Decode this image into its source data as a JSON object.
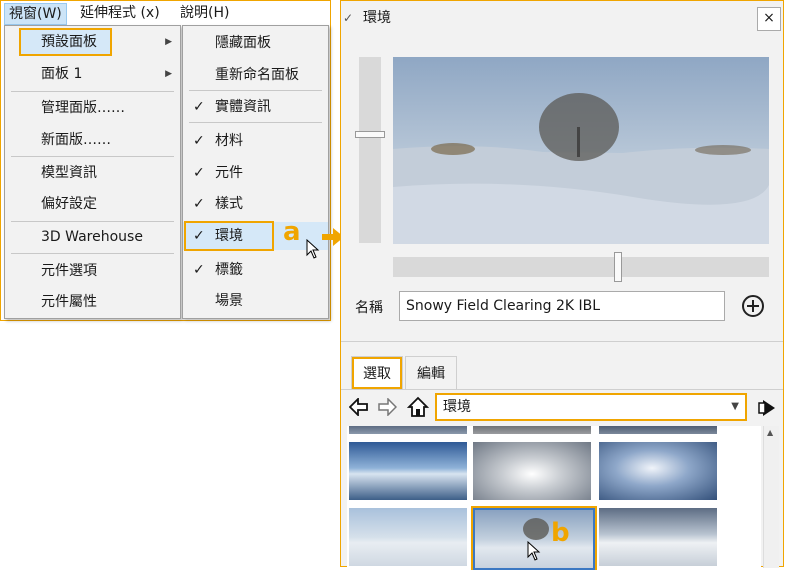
{
  "menubar": {
    "items": [
      "視窗(W)",
      "延伸程式 (x)",
      "說明(H)"
    ]
  },
  "menu_primary": {
    "items": [
      "預設面板",
      "面板 1",
      "管理面版……",
      "新面版……",
      "模型資訊",
      "偏好設定",
      "3D Warehouse",
      "元件選項",
      "元件屬性"
    ]
  },
  "menu_sub": {
    "items": [
      "隱藏面板",
      "重新命名面板",
      "實體資訊",
      "材料",
      "元件",
      "樣式",
      "環境",
      "標籤",
      "場景"
    ]
  },
  "annotations": {
    "a": "a",
    "b": "b"
  },
  "panel": {
    "title": "環境",
    "close": "×",
    "name_label": "名稱",
    "name_value": "Snowy Field Clearing 2K IBL",
    "tabs": [
      "選取",
      "編輯"
    ],
    "combo_value": "環境"
  },
  "colors": {
    "accent": "#f0a500",
    "highlight": "#d5e8f8"
  }
}
